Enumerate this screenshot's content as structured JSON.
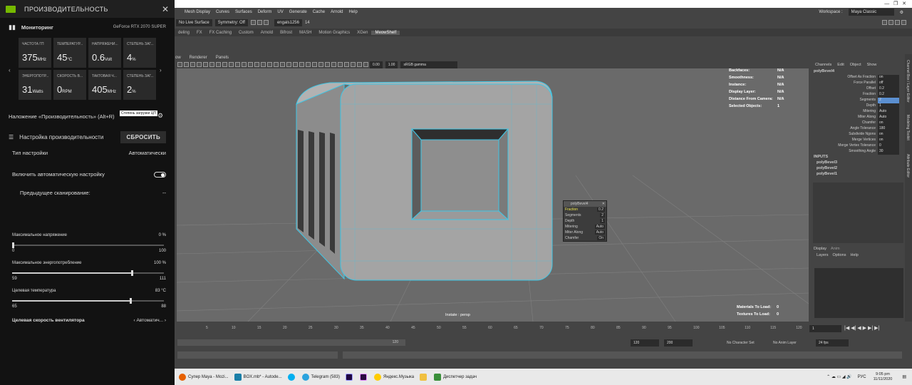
{
  "overlay": {
    "title": "ПРОИЗВОДИТЕЛЬНОСТЬ",
    "monitoring_label": "Мониторинг",
    "gpu_name": "GeForce RTX 2070 SUPER",
    "tiles": [
      {
        "label": "ЧАСТОТА ГП",
        "value": "375",
        "unit": "MHz"
      },
      {
        "label": "ТЕМПЕРАТУР...",
        "value": "45",
        "unit": "°C"
      },
      {
        "label": "НАПРЯЖЕНИ...",
        "value": "0.6",
        "unit": "Volt"
      },
      {
        "label": "СТЕПЕНЬ ЗАГ...",
        "value": "4",
        "unit": "%"
      },
      {
        "label": "ЭНЕРГОПОТР...",
        "value": "31",
        "unit": "Watts"
      },
      {
        "label": "СКОРОСТЬ В...",
        "value": "0",
        "unit": "RPM"
      },
      {
        "label": "ТАКТОВАЯ Ч...",
        "value": "405",
        "unit": "MHz"
      },
      {
        "label": "СТЕПЕНЬ ЗАГ...",
        "value": "2",
        "unit": "%"
      }
    ],
    "overlay_hotkey": "Наложение «Производительность» (Alt+R)",
    "tooltip": "Степень загрузки ЦП",
    "tuning_label": "Настройка производительности",
    "reset_button": "СБРОСИТЬ",
    "tuning_type_label": "Тип настройки",
    "tuning_type_value": "Автоматически",
    "auto_tuning_label": "Включить автоматическую настройку",
    "auto_tuning_enabled": true,
    "prev_scan_label": "Предыдущее сканирование:",
    "prev_scan_value": "--",
    "max_voltage": {
      "label": "Максимальное напряжение",
      "value": "0 %",
      "min": "0",
      "max": "100",
      "fraction": 0.0
    },
    "max_power": {
      "label": "Максимальное энергопотребление",
      "value": "100 %",
      "min": "59",
      "max": "111",
      "fraction": 0.79
    },
    "target_temp": {
      "label": "Целевая температура",
      "value": "83 °C",
      "min": "65",
      "max": "88",
      "fraction": 0.78
    },
    "fan_label": "Целевая скорость вентилятора",
    "fan_value": "Автоматич..."
  },
  "maya": {
    "menu": [
      "Mesh Display",
      "Curves",
      "Surfaces",
      "Deform",
      "UV",
      "Generate",
      "Cache",
      "Arnold",
      "Help"
    ],
    "workspace_label": "Workspace :",
    "workspace_value": "Maya Classic",
    "no_live_surface": "No Live Surface",
    "symmetry": "Symmetry: Off",
    "user": "engals1256",
    "user_count": "14",
    "shelf_tabs": [
      "deling",
      "FX",
      "FX Caching",
      "Custom",
      "Arnold",
      "Bifrost",
      "MASH",
      "Motion Graphics",
      "XGen",
      "MeowShelf"
    ],
    "shelf_selected": "MeowShelf",
    "viewport_menu": [
      "ow",
      "Renderer",
      "Panels"
    ],
    "exposure": "0.00",
    "gamma": "1.00",
    "colorspace": "sRGB gamma",
    "hud_left": [
      "Backfaces:",
      "Smoothness:",
      "Instance:",
      "Display Layer:",
      "Distance From Camera:",
      "Selected Objects:"
    ],
    "hud_right": [
      "N/A",
      "N/A",
      "N/A",
      "N/A",
      "N/A",
      "1"
    ],
    "camera_label": "Instate : persp",
    "materials_to_load": "Materials To Load:",
    "materials_value": "0",
    "textures_to_load": "Textures To Load:",
    "textures_value": "0",
    "popup": {
      "title": "polyBevel4",
      "rows": [
        [
          "Fraction",
          "0.2"
        ],
        [
          "Segments",
          "2"
        ],
        [
          "Depth",
          "1"
        ],
        [
          "Mitering",
          "Auto"
        ],
        [
          "Miter Along",
          "Auto"
        ],
        [
          "Chamfer",
          "On"
        ]
      ]
    },
    "channel_tabs": [
      "Channels",
      "Edit",
      "Object",
      "Show"
    ],
    "node_name": "polyBevel4",
    "attrs": [
      [
        "Offset As Fraction",
        "on"
      ],
      [
        "Force Parallel",
        "off"
      ],
      [
        "Offset",
        "0.2"
      ],
      [
        "Fraction",
        "0.2"
      ],
      [
        "Segments",
        "2"
      ],
      [
        "Depth",
        "1"
      ],
      [
        "Mitering",
        "Auto"
      ],
      [
        "Miter Along",
        "Auto"
      ],
      [
        "Chamfer",
        "on"
      ],
      [
        "Angle Tolerance",
        "180"
      ],
      [
        "Subdivide Ngons",
        "on"
      ],
      [
        "Merge Vertices",
        "on"
      ],
      [
        "Merge Vertex Tolerance",
        "0"
      ],
      [
        "Smoothing Angle",
        "30"
      ]
    ],
    "inputs_label": "INPUTS",
    "inputs": [
      "polyBevel3",
      "polyBevel2",
      "polyBevel1"
    ],
    "layer_tabs": [
      "Display",
      "Anim"
    ],
    "layer_menu": [
      "Layers",
      "Options",
      "Help"
    ],
    "timeline_ticks": [
      "5",
      "10",
      "15",
      "20",
      "25",
      "30",
      "35",
      "40",
      "45",
      "50",
      "55",
      "60",
      "65",
      "70",
      "75",
      "80",
      "85",
      "90",
      "95",
      "100",
      "105",
      "110",
      "115",
      "120"
    ],
    "current_frame": "1",
    "range_start": "120",
    "range_end": "120",
    "range_end2": "200",
    "no_char_set": "No Character Set",
    "no_anim_layer": "No Anim Layer",
    "fps": "24 fps",
    "side_tabs": [
      "Channel Box / Layer Editor",
      "Modeling Toolkit",
      "Attribute Editor"
    ]
  },
  "taskbar": {
    "items": [
      "Супер Maya - Mozi...",
      "BOX.mb* - Autode...",
      "Telegram (583)",
      "Яндекс.Музыка",
      "Диспетчер задач"
    ],
    "lang": "РУС",
    "time": "9:05 pm",
    "date": "11/11/2020"
  },
  "colors": {
    "nvidia": "#76b900",
    "wire": "#3fc7e6",
    "accent": "#5b8fd0"
  }
}
